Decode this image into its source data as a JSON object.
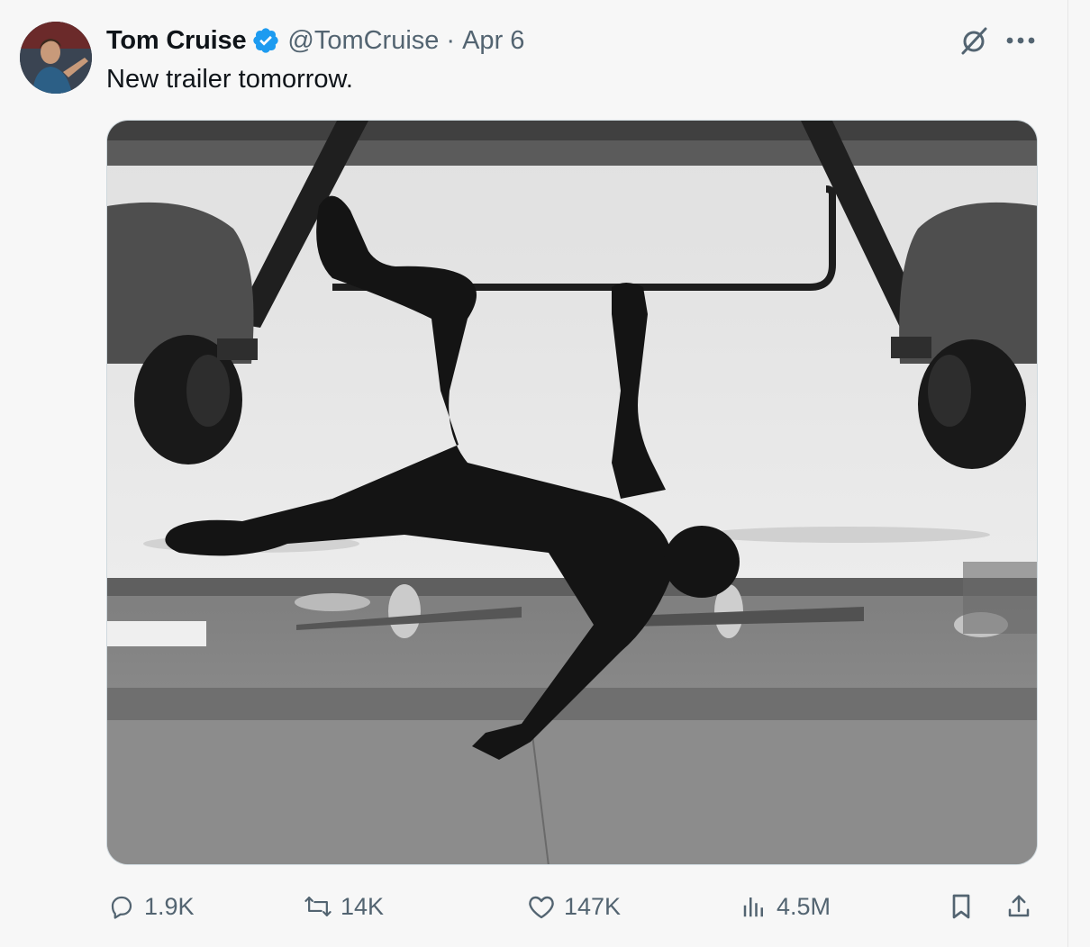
{
  "author": {
    "name": "Tom Cruise",
    "handle": "@TomCruise",
    "separator": "·",
    "date": "Apr 6",
    "verified": true,
    "verified_color": "#1d9bf0"
  },
  "tweet": {
    "text": "New trailer tomorrow."
  },
  "header_icons": [
    "grok-icon",
    "more-icon"
  ],
  "media": {
    "kind": "photo",
    "tone": "black-and-white"
  },
  "actions": {
    "replies": "1.9K",
    "reposts": "14K",
    "likes": "147K",
    "views": "4.5M"
  },
  "colors": {
    "text": "#0f1419",
    "secondary": "#536471",
    "background": "#f7f7f7",
    "border": "#cfd9de"
  }
}
